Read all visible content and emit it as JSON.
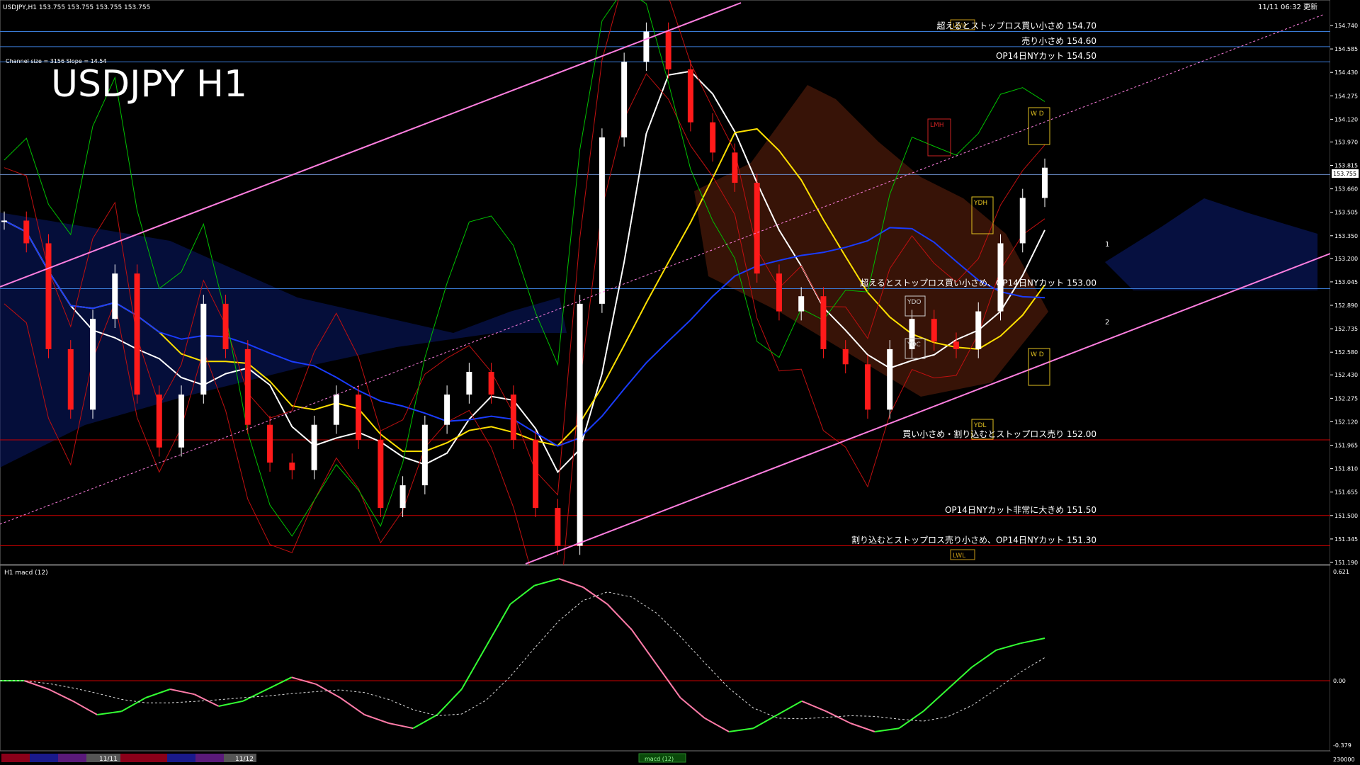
{
  "window": {
    "header_info": "USDJPY,H1  153.755 153.755 153.755 153.755",
    "timestamp": "11/11 06:32 更新",
    "big_title": "USDJPY H1",
    "channel_info": "Channel size = 3156 Slope = 14.54",
    "current_price": "153.755"
  },
  "price_axis": {
    "ticks": [
      "154.740",
      "154.585",
      "154.430",
      "154.275",
      "154.120",
      "153.970",
      "153.815",
      "153.660",
      "153.505",
      "153.350",
      "153.200",
      "153.045",
      "152.890",
      "152.735",
      "152.580",
      "152.430",
      "152.275",
      "152.120",
      "151.965",
      "151.810",
      "151.655",
      "151.500",
      "151.345",
      "151.190"
    ]
  },
  "annotations": [
    {
      "id": "r1",
      "text": "超えるとストップロス買い小さめ 154.70",
      "price": 154.7,
      "color": "#3a7bd5"
    },
    {
      "id": "r2",
      "text": "売り小さめ 154.60",
      "price": 154.6,
      "color": "#3a7bd5"
    },
    {
      "id": "r3",
      "text": "OP14日NYカット 154.50",
      "price": 154.5,
      "color": "#3a7bd5"
    },
    {
      "id": "m1",
      "text": "超えるとストップロス買い小さめ、OP14日NYカット 153.00",
      "price": 153.0,
      "color": "#3a7bd5"
    },
    {
      "id": "s1",
      "text": "買い小さめ・割り込むとストップロス売り 152.00",
      "price": 152.0,
      "color": "#cc0000"
    },
    {
      "id": "s2",
      "text": "OP14日NYカット非常に大きめ 151.50",
      "price": 151.5,
      "color": "#cc0000"
    },
    {
      "id": "s3",
      "text": "割り込むとストップロス売り小さめ、OP14日NYカット 151.30",
      "price": 151.3,
      "color": "#cc0000"
    }
  ],
  "level_boxes": {
    "lmh": "LMH",
    "lwh": "LWH",
    "ydh": "YDH",
    "ydo": "YDO",
    "ydc": "YDC",
    "ydl": "YDL",
    "lwl": "LWL",
    "wd_top": "W D",
    "wd_bottom": "W D",
    "proj_1": "1",
    "proj_2": "2"
  },
  "macd": {
    "label": "H1  macd (12)",
    "ticks": [
      "0.621",
      "0.00",
      "-0.379"
    ]
  },
  "bottom_bar": {
    "dates": [
      "11/11",
      "11/12"
    ],
    "indicator_tab": "macd (12)",
    "right_value": "230000"
  },
  "colors": {
    "background": "#000000",
    "bull_candle": "#ffffff",
    "bear_candle": "#ff1a1a",
    "channel": "#ff7fe0",
    "ma_white": "#ffffff",
    "ma_yellow": "#ffe000",
    "ma_blue": "#1a3cff",
    "green_line": "#00c000",
    "macd_up": "#33ff33",
    "macd_down": "#ff7ba8",
    "blue_level": "#3a7bd5",
    "red_level": "#cc0000"
  }
}
